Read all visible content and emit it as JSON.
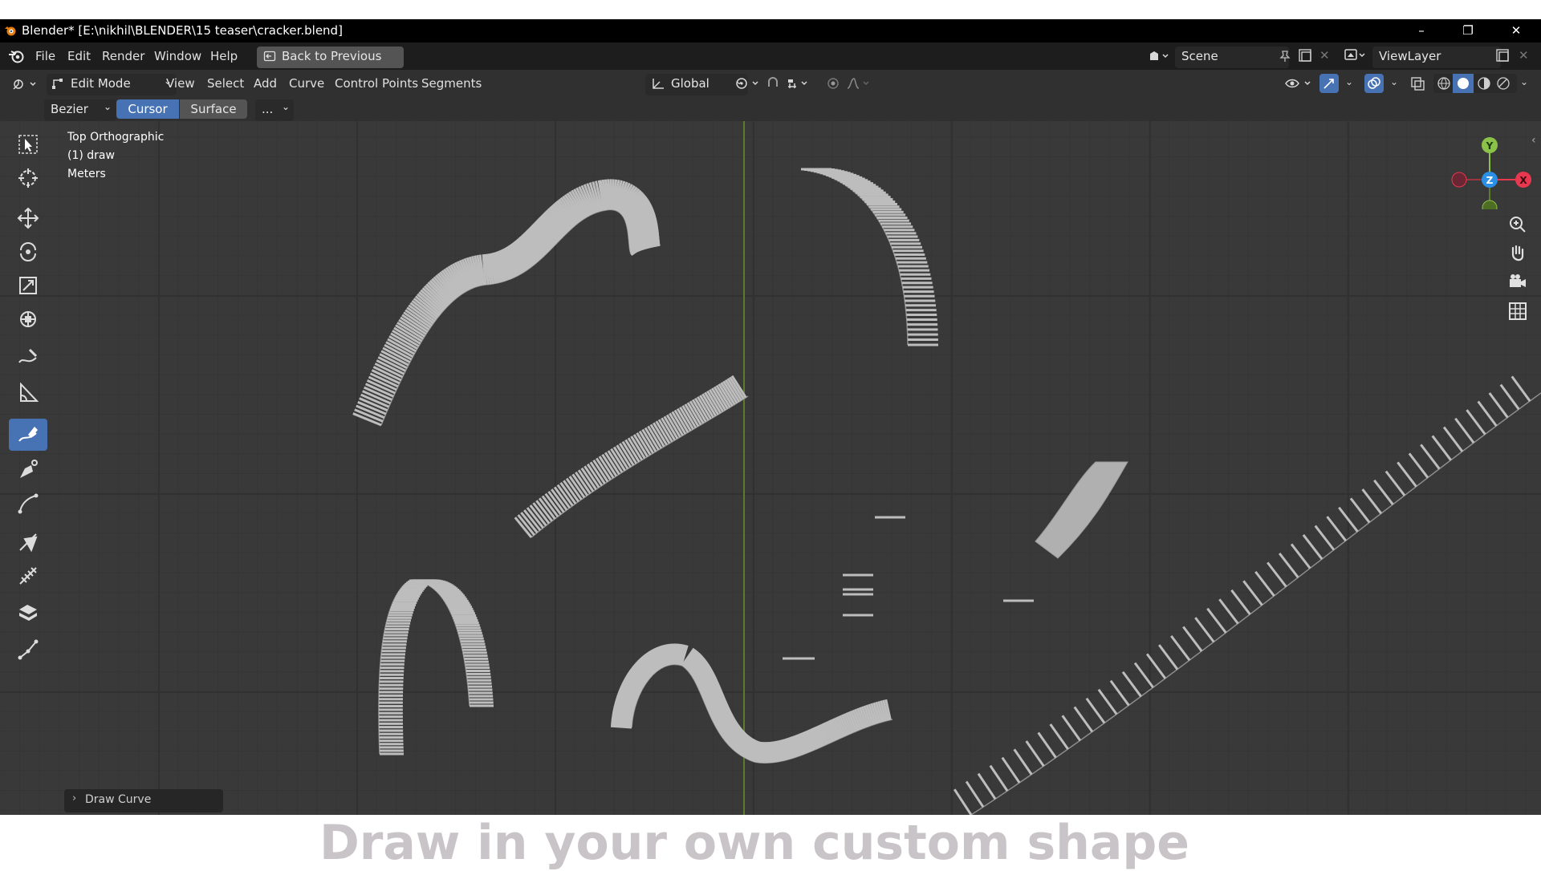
{
  "window": {
    "title": "Blender* [E:\\nikhil\\BLENDER\\15 teaser\\cracker.blend]",
    "controls": [
      "–",
      "❐",
      "✕"
    ]
  },
  "menubar": {
    "items": [
      "File",
      "Edit",
      "Render",
      "Window",
      "Help"
    ],
    "back_button": "Back to Previous",
    "scene_label": "Scene",
    "viewlayer_label": "ViewLayer"
  },
  "header": {
    "mode": "Edit Mode",
    "menus": [
      "View",
      "Select",
      "Add",
      "Curve",
      "Control Points",
      "Segments"
    ],
    "orientation": "Global"
  },
  "tool_settings": {
    "curve_type": "Bezier",
    "depth_options": [
      "Cursor",
      "Surface"
    ],
    "depth_selected": "Cursor",
    "more": "..."
  },
  "viewport": {
    "view_name": "Top Orthographic",
    "object": "(1) draw",
    "units": "Meters",
    "gizmo_axes": [
      "Y",
      "Z",
      "X"
    ]
  },
  "toolbar": {
    "tools": [
      "select-box",
      "cursor",
      "move",
      "rotate",
      "scale",
      "transform",
      "annotate",
      "measure",
      "draw-curve",
      "pen",
      "extrude-cursor",
      "tilt",
      "radius",
      "randomize",
      "extrude"
    ],
    "active_tool": "draw-curve"
  },
  "operator_panel": {
    "label": "Draw Curve"
  },
  "caption": {
    "text": "Draw in your own custom shape"
  },
  "colors": {
    "accent": "#4772b3",
    "axis_x": "#e8384f",
    "axis_y": "#8bc34a",
    "axis_z": "#2c8fe6"
  }
}
